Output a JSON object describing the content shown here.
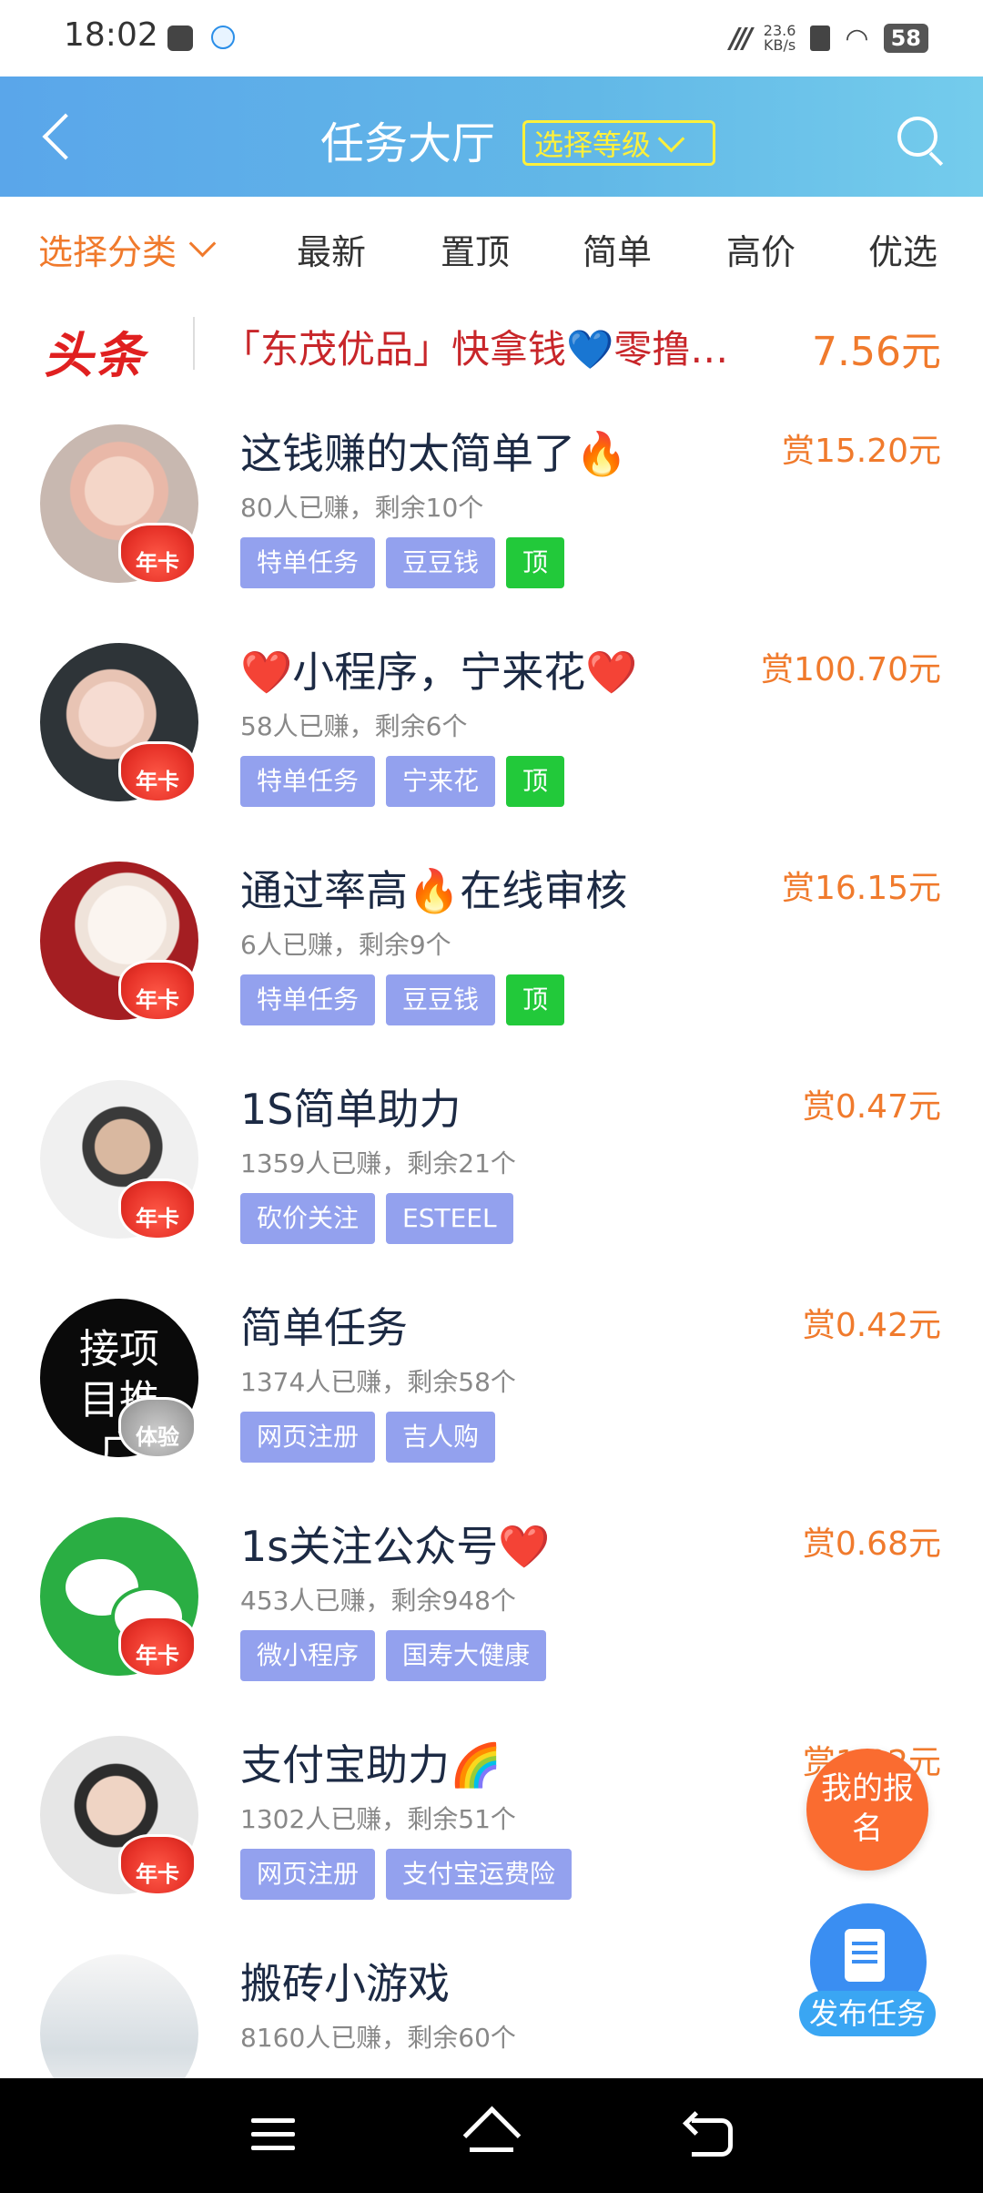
{
  "status": {
    "time": "18:02",
    "net_speed_value": "23.6",
    "net_speed_unit": "KB/s",
    "battery": "58"
  },
  "header": {
    "title": "任务大厅",
    "level_select": "选择等级"
  },
  "filters": {
    "category": "选择分类",
    "tabs": [
      "最新",
      "置顶",
      "简单",
      "高价",
      "优选"
    ]
  },
  "headline": {
    "logo": "头条",
    "text": "「东茂优品」快拿钱💙零撸…",
    "price": "7.56元"
  },
  "tasks": [
    {
      "title": "这钱赚的太简单了🔥",
      "stats": "80人已赚，剩余10个",
      "reward": "赏15.20元",
      "badge": "年卡",
      "tags": [
        "特单任务",
        "豆豆钱"
      ],
      "top": "顶"
    },
    {
      "title": "❤️小程序，宁来花❤️",
      "stats": "58人已赚，剩余6个",
      "reward": "赏100.70元",
      "badge": "年卡",
      "tags": [
        "特单任务",
        "宁来花"
      ],
      "top": "顶"
    },
    {
      "title": "通过率高🔥在线审核",
      "stats": "6人已赚，剩余9个",
      "reward": "赏16.15元",
      "badge": "年卡",
      "tags": [
        "特单任务",
        "豆豆钱"
      ],
      "top": "顶"
    },
    {
      "title": "1S简单助力",
      "stats": "1359人已赚，剩余21个",
      "reward": "赏0.47元",
      "badge": "年卡",
      "tags": [
        "砍价关注",
        "ESTEEL"
      ]
    },
    {
      "title": "简单任务",
      "stats": "1374人已赚，剩余58个",
      "reward": "赏0.42元",
      "badge": "体验",
      "avatar_text": "接项目推广",
      "tags": [
        "网页注册",
        "吉人购"
      ]
    },
    {
      "title": "1s关注公众号❤️",
      "stats": "453人已赚，剩余948个",
      "reward": "赏0.68元",
      "badge": "年卡",
      "tags": [
        "微小程序",
        "国寿大健康"
      ]
    },
    {
      "title": "支付宝助力🌈",
      "stats": "1302人已赚，剩余51个",
      "reward": "赏1.02元",
      "badge": "年卡",
      "tags": [
        "网页注册",
        "支付宝运费险"
      ]
    },
    {
      "title": "搬砖小游戏",
      "stats": "8160人已赚，剩余60个",
      "reward": "",
      "badge": "",
      "tags": []
    }
  ],
  "fab": {
    "join": "我的报名",
    "publish": "发布任务"
  },
  "colors": {
    "accent": "#f07a2c",
    "tag": "#93a1ee",
    "top": "#22c93a",
    "header_start": "#5aa6ea",
    "header_end": "#74ccec"
  }
}
